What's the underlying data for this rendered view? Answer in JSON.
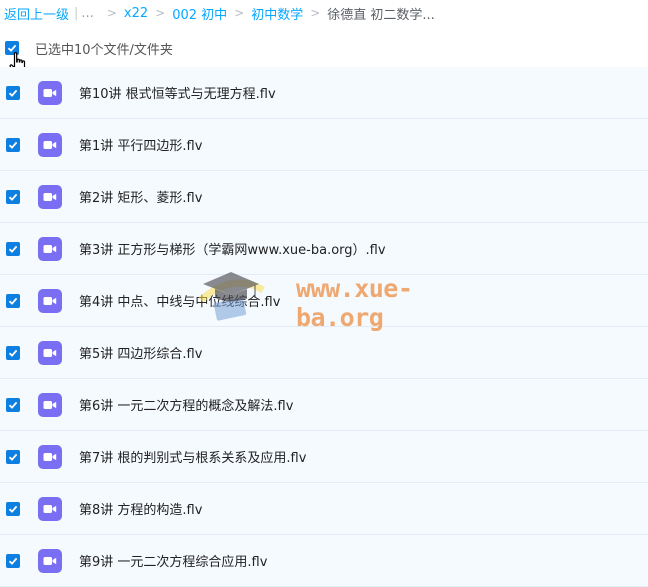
{
  "breadcrumb": {
    "back": "返回上一级",
    "ellipsis": "...",
    "items": [
      "x22",
      "002 初中",
      "初中数学"
    ],
    "current": "徐德直 初二数学..."
  },
  "selection": {
    "label": "已选中10个文件/文件夹",
    "all_checked": true
  },
  "files": [
    {
      "name": "第10讲 根式恒等式与无理方程.flv",
      "checked": true,
      "icon": "video-file-icon"
    },
    {
      "name": "第1讲 平行四边形.flv",
      "checked": true,
      "icon": "video-file-icon"
    },
    {
      "name": "第2讲 矩形、菱形.flv",
      "checked": true,
      "icon": "video-file-icon"
    },
    {
      "name": "第3讲 正方形与梯形（学霸网www.xue-ba.org）.flv",
      "checked": true,
      "icon": "video-file-icon"
    },
    {
      "name": "第4讲 中点、中线与中位线综合.flv",
      "checked": true,
      "icon": "video-file-icon"
    },
    {
      "name": "第5讲 四边形综合.flv",
      "checked": true,
      "icon": "video-file-icon"
    },
    {
      "name": "第6讲 一元二次方程的概念及解法.flv",
      "checked": true,
      "icon": "video-file-icon"
    },
    {
      "name": "第7讲 根的判别式与根系关系及应用.flv",
      "checked": true,
      "icon": "video-file-icon"
    },
    {
      "name": "第8讲 方程的构造.flv",
      "checked": true,
      "icon": "video-file-icon"
    },
    {
      "name": "第9讲 一元二次方程综合应用.flv",
      "checked": true,
      "icon": "video-file-icon"
    }
  ],
  "watermark": {
    "text": "www.xue-ba.org"
  },
  "colors": {
    "accent": "#06a7ff",
    "checkbox": "#0d7fe0",
    "video_icon": "#7a6ef2",
    "row_bg": "#f5faff"
  }
}
